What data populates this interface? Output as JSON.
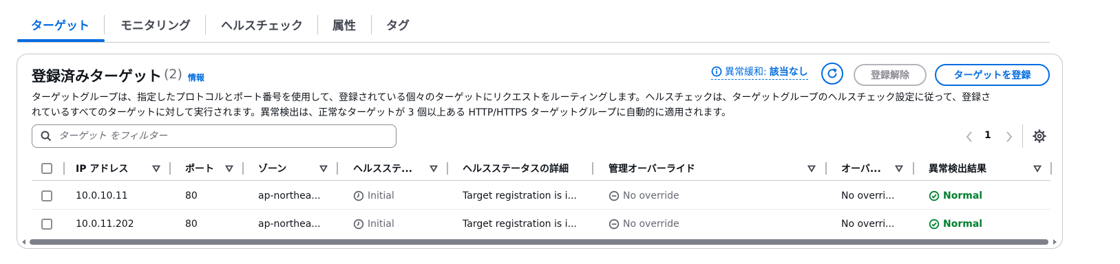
{
  "tabs": [
    {
      "label": "ターゲット",
      "active": true
    },
    {
      "label": "モニタリング"
    },
    {
      "label": "ヘルスチェック"
    },
    {
      "label": "属性"
    },
    {
      "label": "タグ"
    }
  ],
  "header": {
    "title": "登録済みターゲット",
    "count": "(2)",
    "info_link": "情報",
    "mitigation_label": "異常緩和:",
    "mitigation_value": "該当なし",
    "deregister_label": "登録解除",
    "register_label": "ターゲットを登録"
  },
  "description": {
    "line1": "ターゲットグループは、指定したプロトコルとポート番号を使用して、登録されている個々のターゲットにリクエストをルーティングします。ヘルスチェックは、ターゲットグループのヘルスチェック設定に従って、登録さ",
    "line2": "れているすべてのターゲットに対して実行されます。異常検出は、正常なターゲットが 3 個以上ある HTTP/HTTPS ターゲットグループに自動的に適用されます。"
  },
  "search": {
    "placeholder": "ターゲット をフィルター",
    "value": ""
  },
  "pagination": {
    "current_page": "1"
  },
  "table": {
    "columns": [
      "IP アドレス",
      "ポート",
      "ゾーン",
      "ヘルスステ...",
      "ヘルスステータスの詳細",
      "管理オーバーライド",
      "オーバ...",
      "異常検出結果"
    ],
    "rows": [
      {
        "ip": "10.0.10.11",
        "port": "80",
        "zone": "ap-northea...",
        "health": "Initial",
        "detail": "Target registration is i...",
        "override": "No override",
        "override2": "No overri...",
        "anomaly": "Normal"
      },
      {
        "ip": "10.0.11.202",
        "port": "80",
        "zone": "ap-northea...",
        "health": "Initial",
        "detail": "Target registration is i...",
        "override": "No override",
        "override2": "No overri...",
        "anomaly": "Normal"
      }
    ]
  },
  "colors": {
    "accent": "#006ce0",
    "success": "#00802f",
    "muted": "#656871",
    "border": "#c6c6cd"
  }
}
